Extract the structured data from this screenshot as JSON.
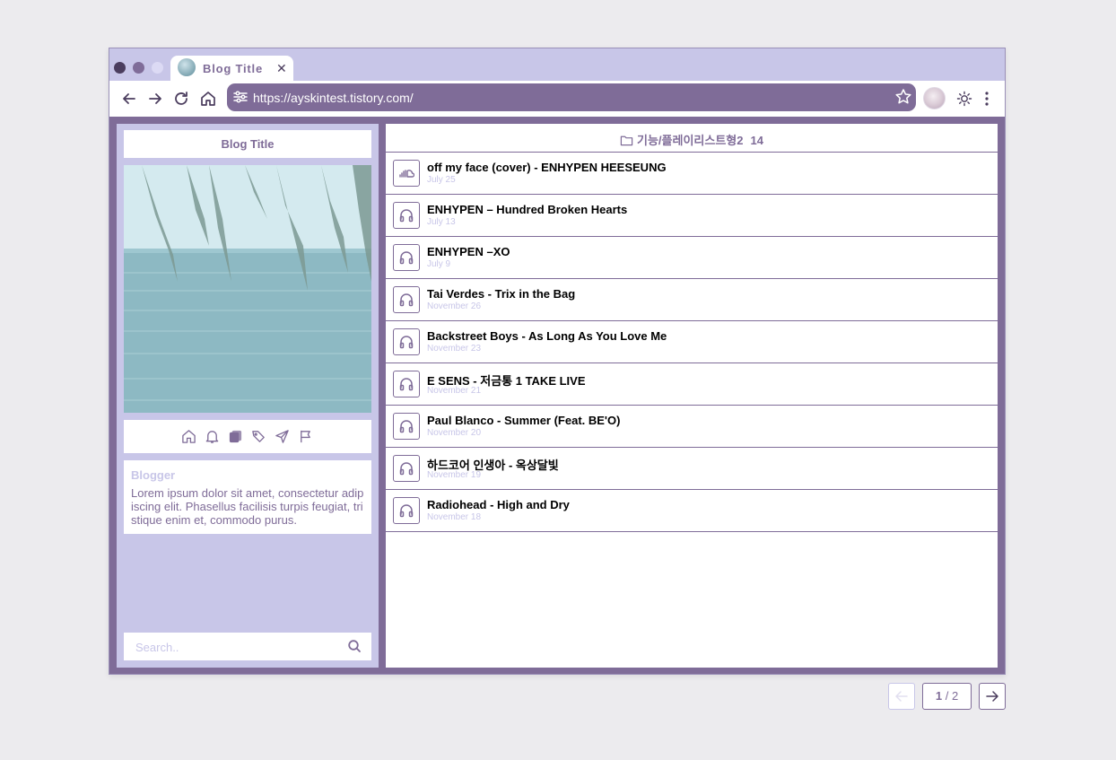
{
  "browser": {
    "tab": {
      "title": "Blog Title",
      "close": "✕"
    },
    "url": "https://ayskintest.tistory.com/"
  },
  "sidebar": {
    "title": "Blog Title",
    "icons": [
      "home-icon",
      "bell-icon",
      "folders-icon",
      "tags-icon",
      "send-icon",
      "flag-icon"
    ],
    "blogger": {
      "name": "Blogger",
      "description": "Lorem ipsum dolor sit amet, consectetur adipiscing elit. Phasellus facilisis turpis feugiat, tristique enim et, commodo purus."
    },
    "search": {
      "placeholder": "Search.."
    }
  },
  "main": {
    "category": {
      "name": "기능/플레이리스트형2",
      "count": "14"
    },
    "posts": [
      {
        "title": "off my face (cover) - ENHYPEN HEESEUNG",
        "date": "July 25",
        "icon": "soundcloud-icon"
      },
      {
        "title": "ENHYPEN – Hundred Broken Hearts",
        "date": "July 13",
        "icon": "headphones-icon"
      },
      {
        "title": "ENHYPEN –XO",
        "date": "July 9",
        "icon": "headphones-icon"
      },
      {
        "title": "Tai Verdes - Trix in the Bag",
        "date": "November 26",
        "icon": "headphones-icon"
      },
      {
        "title": "Backstreet Boys - As Long As You Love Me",
        "date": "November 23",
        "icon": "headphones-icon"
      },
      {
        "title": "E SENS - 저금통 1 TAKE LIVE",
        "date": "November 21",
        "icon": "headphones-icon"
      },
      {
        "title": "Paul Blanco - Summer (Feat. BE'O)",
        "date": "November 20",
        "icon": "headphones-icon"
      },
      {
        "title": "하드코어 인생아 - 옥상달빛",
        "date": "November 19",
        "icon": "headphones-icon"
      },
      {
        "title": "Radiohead - High and Dry",
        "date": "November 18",
        "icon": "headphones-icon"
      }
    ]
  },
  "pagination": {
    "current": "1",
    "separator": "/",
    "total": "2"
  },
  "colors": {
    "accent": "#7f6c98",
    "light": "#c8c6e8",
    "dark": "#4b3d5e",
    "background": "#ecebee"
  }
}
